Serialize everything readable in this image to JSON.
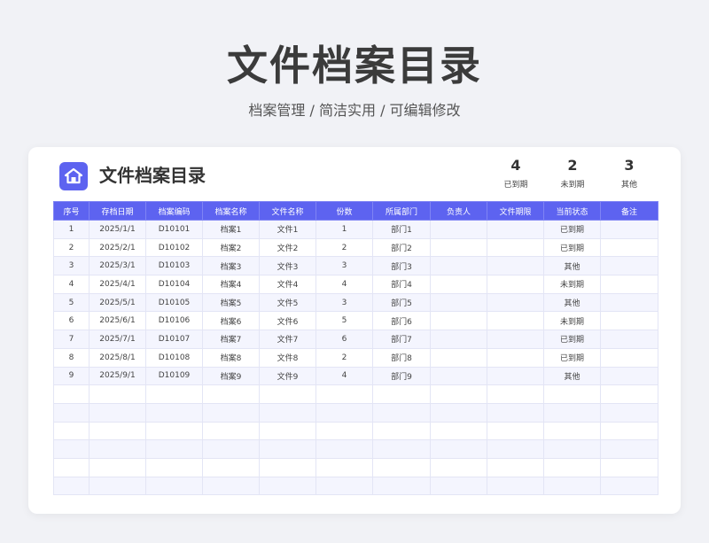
{
  "page": {
    "title": "文件档案目录",
    "subtitle": "档案管理 /  简洁实用  /  可编辑修改"
  },
  "card": {
    "title": "文件档案目录",
    "stats": [
      {
        "value": "4",
        "label": "已到期"
      },
      {
        "value": "2",
        "label": "未到期"
      },
      {
        "value": "3",
        "label": "其他"
      }
    ]
  },
  "colors": {
    "accent": "#5d63f0",
    "page_bg": "#f1f2f6",
    "row_alt": "#f4f5fe"
  },
  "icons": {
    "logo": "home-icon"
  },
  "table": {
    "headers": [
      "序号",
      "存档日期",
      "档案编码",
      "档案名称",
      "文件名称",
      "份数",
      "所属部门",
      "负责人",
      "文件期限",
      "当前状态",
      "备注"
    ],
    "rows": [
      [
        "1",
        "2025/1/1",
        "D10101",
        "档案1",
        "文件1",
        "1",
        "部门1",
        "",
        "",
        "已到期",
        ""
      ],
      [
        "2",
        "2025/2/1",
        "D10102",
        "档案2",
        "文件2",
        "2",
        "部门2",
        "",
        "",
        "已到期",
        ""
      ],
      [
        "3",
        "2025/3/1",
        "D10103",
        "档案3",
        "文件3",
        "3",
        "部门3",
        "",
        "",
        "其他",
        ""
      ],
      [
        "4",
        "2025/4/1",
        "D10104",
        "档案4",
        "文件4",
        "4",
        "部门4",
        "",
        "",
        "未到期",
        ""
      ],
      [
        "5",
        "2025/5/1",
        "D10105",
        "档案5",
        "文件5",
        "3",
        "部门5",
        "",
        "",
        "其他",
        ""
      ],
      [
        "6",
        "2025/6/1",
        "D10106",
        "档案6",
        "文件6",
        "5",
        "部门6",
        "",
        "",
        "未到期",
        ""
      ],
      [
        "7",
        "2025/7/1",
        "D10107",
        "档案7",
        "文件7",
        "6",
        "部门7",
        "",
        "",
        "已到期",
        ""
      ],
      [
        "8",
        "2025/8/1",
        "D10108",
        "档案8",
        "文件8",
        "2",
        "部门8",
        "",
        "",
        "已到期",
        ""
      ],
      [
        "9",
        "2025/9/1",
        "D10109",
        "档案9",
        "文件9",
        "4",
        "部门9",
        "",
        "",
        "其他",
        ""
      ],
      [
        "",
        "",
        "",
        "",
        "",
        "",
        "",
        "",
        "",
        "",
        ""
      ],
      [
        "",
        "",
        "",
        "",
        "",
        "",
        "",
        "",
        "",
        "",
        ""
      ],
      [
        "",
        "",
        "",
        "",
        "",
        "",
        "",
        "",
        "",
        "",
        ""
      ],
      [
        "",
        "",
        "",
        "",
        "",
        "",
        "",
        "",
        "",
        "",
        ""
      ],
      [
        "",
        "",
        "",
        "",
        "",
        "",
        "",
        "",
        "",
        "",
        ""
      ],
      [
        "",
        "",
        "",
        "",
        "",
        "",
        "",
        "",
        "",
        "",
        ""
      ]
    ]
  }
}
